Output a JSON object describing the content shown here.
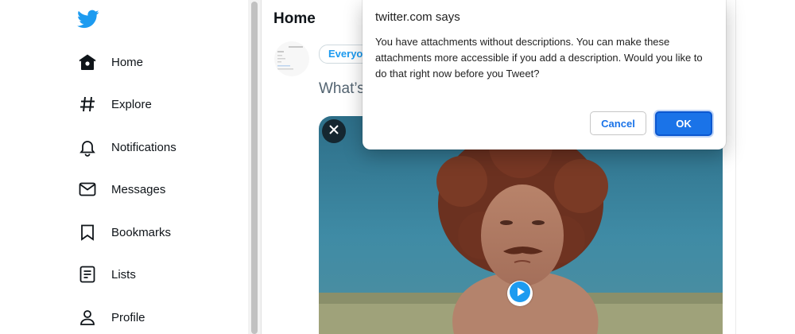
{
  "sidebar": {
    "items": [
      {
        "label": "Home",
        "icon": "home-icon"
      },
      {
        "label": "Explore",
        "icon": "hashtag-icon"
      },
      {
        "label": "Notifications",
        "icon": "bell-icon"
      },
      {
        "label": "Messages",
        "icon": "mail-icon"
      },
      {
        "label": "Bookmarks",
        "icon": "bookmark-icon"
      },
      {
        "label": "Lists",
        "icon": "list-icon"
      },
      {
        "label": "Profile",
        "icon": "user-icon"
      }
    ]
  },
  "main": {
    "title": "Home",
    "audience_label": "Everyo",
    "compose_placeholder": "What’s"
  },
  "dialog": {
    "title": "twitter.com says",
    "message": "You have attachments without descriptions. You can make these attachments more accessible if you add a description. Would you like to do that right now before you Tweet?",
    "cancel_label": "Cancel",
    "ok_label": "OK"
  },
  "colors": {
    "brand": "#1d9bf0",
    "dialog_primary": "#1a73e8"
  }
}
